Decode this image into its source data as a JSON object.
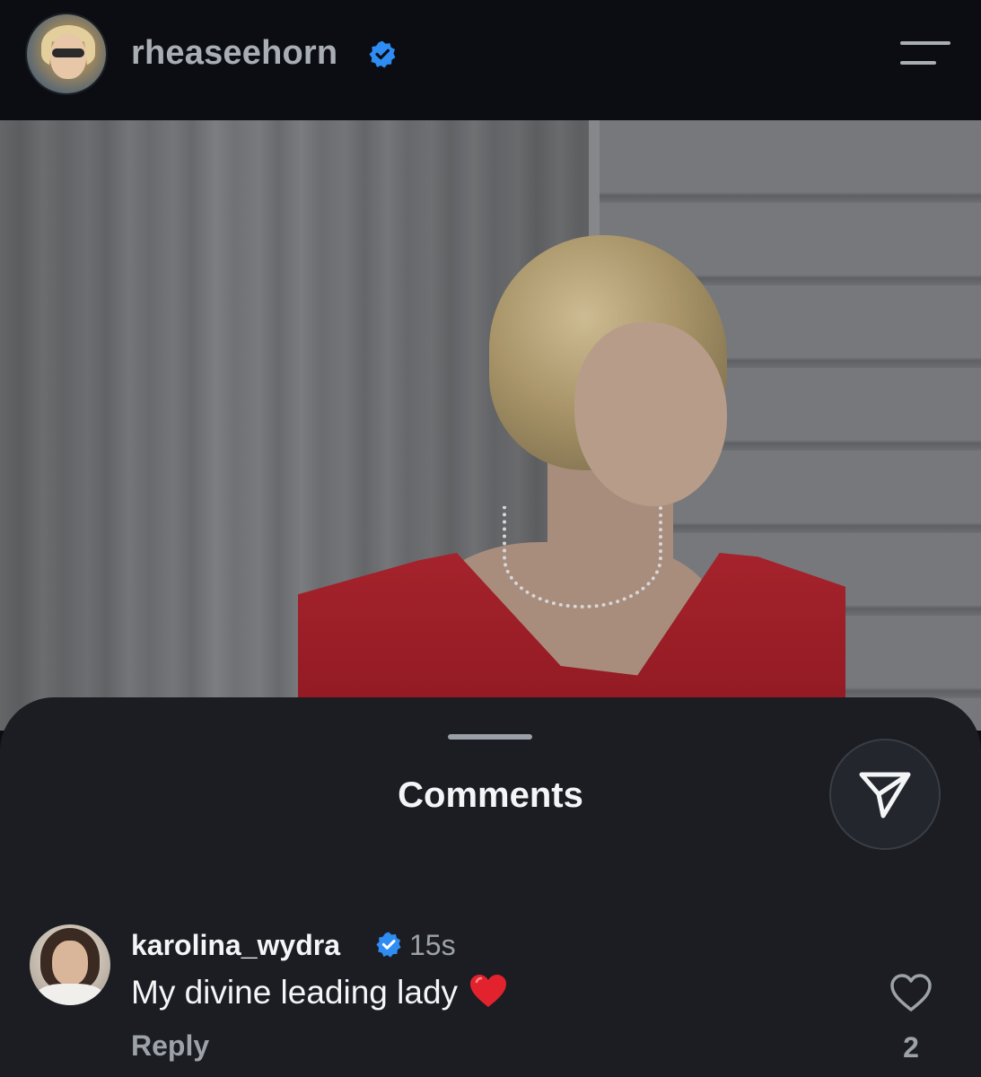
{
  "header": {
    "username": "rheaseehorn",
    "verified": true
  },
  "post": {
    "image": "portrait-photo"
  },
  "comments_sheet": {
    "title": "Comments",
    "comments": [
      {
        "username": "karolina_wydra",
        "verified": true,
        "time": "15s",
        "text": "My divine leading lady",
        "emoji": "red-heart",
        "reply_label": "Reply",
        "likes": "2"
      }
    ]
  },
  "colors": {
    "background": "#0b0d12",
    "sheet": "#1b1d22",
    "verified_badge": "#2f8cf3",
    "muted_text": "#9da2a9",
    "dress_red": "#a5232c"
  }
}
